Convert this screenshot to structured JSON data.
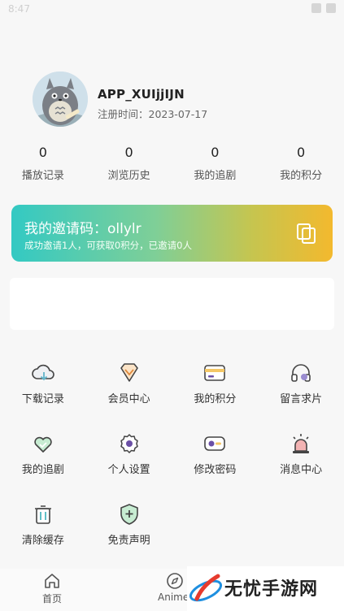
{
  "status": {
    "time": "8:47"
  },
  "profile": {
    "username": "APP_XUIjjIJN",
    "register_label": "注册时间：2023-07-17"
  },
  "stats": [
    {
      "value": "0",
      "label": "播放记录"
    },
    {
      "value": "0",
      "label": "浏览历史"
    },
    {
      "value": "0",
      "label": "我的追剧"
    },
    {
      "value": "0",
      "label": "我的积分"
    }
  ],
  "invite": {
    "title": "我的邀请码：ollylr",
    "subtitle": "成功邀请1人，可获取0积分，已邀请0人"
  },
  "menu": [
    {
      "label": "下载记录",
      "icon": "cloud-download-icon"
    },
    {
      "label": "会员中心",
      "icon": "vip-diamond-icon"
    },
    {
      "label": "我的积分",
      "icon": "card-icon"
    },
    {
      "label": "留言求片",
      "icon": "headphones-icon"
    },
    {
      "label": "我的追剧",
      "icon": "heart-icon"
    },
    {
      "label": "个人设置",
      "icon": "gear-icon"
    },
    {
      "label": "修改密码",
      "icon": "password-icon"
    },
    {
      "label": "消息中心",
      "icon": "alarm-icon"
    },
    {
      "label": "清除缓存",
      "icon": "trash-icon"
    },
    {
      "label": "免责声明",
      "icon": "shield-icon"
    }
  ],
  "tabs": [
    {
      "label": "首页",
      "icon": "home-icon"
    },
    {
      "label": "Animel",
      "icon": "compass-icon"
    }
  ],
  "watermark": {
    "text": "无忧手游网"
  },
  "colors": {
    "accent_teal": "#33c9c3",
    "accent_yellow": "#f3b92e",
    "icon_purple": "#6b4fa6"
  }
}
